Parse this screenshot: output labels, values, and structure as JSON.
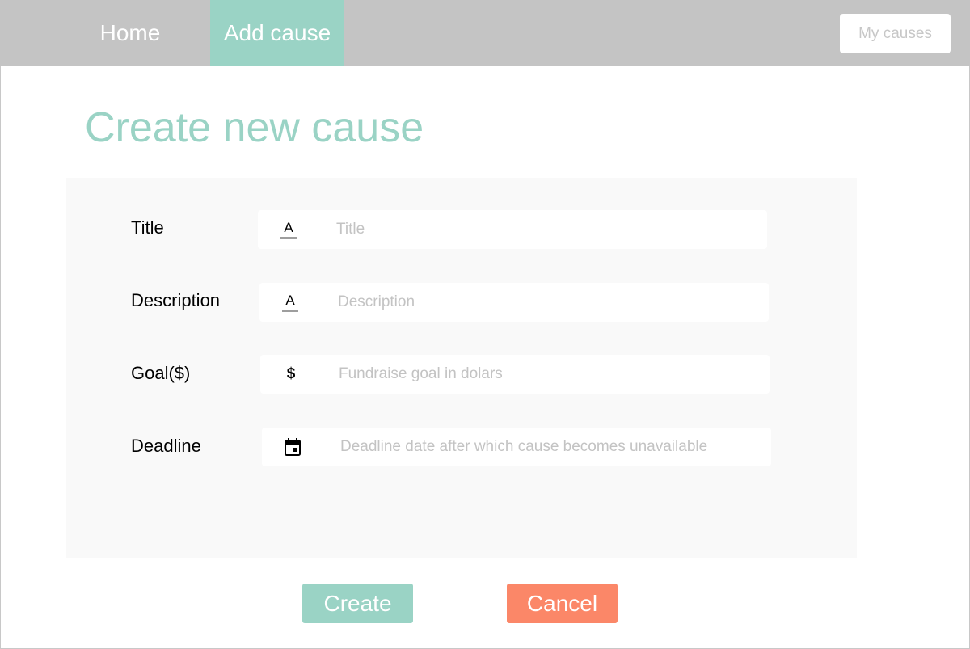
{
  "nav": {
    "home_label": "Home",
    "add_cause_label": "Add cause",
    "my_causes_label": "My causes"
  },
  "page": {
    "title": "Create new cause"
  },
  "form": {
    "title": {
      "label": "Title",
      "placeholder": "Title",
      "icon": "text-format-icon",
      "icon_glyph": "A"
    },
    "description": {
      "label": "Description",
      "placeholder": "Description",
      "icon": "text-format-icon",
      "icon_glyph": "A"
    },
    "goal": {
      "label": "Goal($)",
      "placeholder": "Fundraise goal in dolars",
      "icon": "dollar-icon",
      "icon_glyph": "$"
    },
    "deadline": {
      "label": "Deadline",
      "placeholder": "Deadline date after which cause becomes unavailable",
      "icon": "calendar-icon"
    }
  },
  "actions": {
    "create_label": "Create",
    "cancel_label": "Cancel"
  },
  "colors": {
    "accent": "#9ad3c5",
    "cancel": "#fb8768",
    "topbar": "#c4c4c4",
    "panel": "#f9f9f9",
    "placeholder": "#c3c3c3"
  }
}
